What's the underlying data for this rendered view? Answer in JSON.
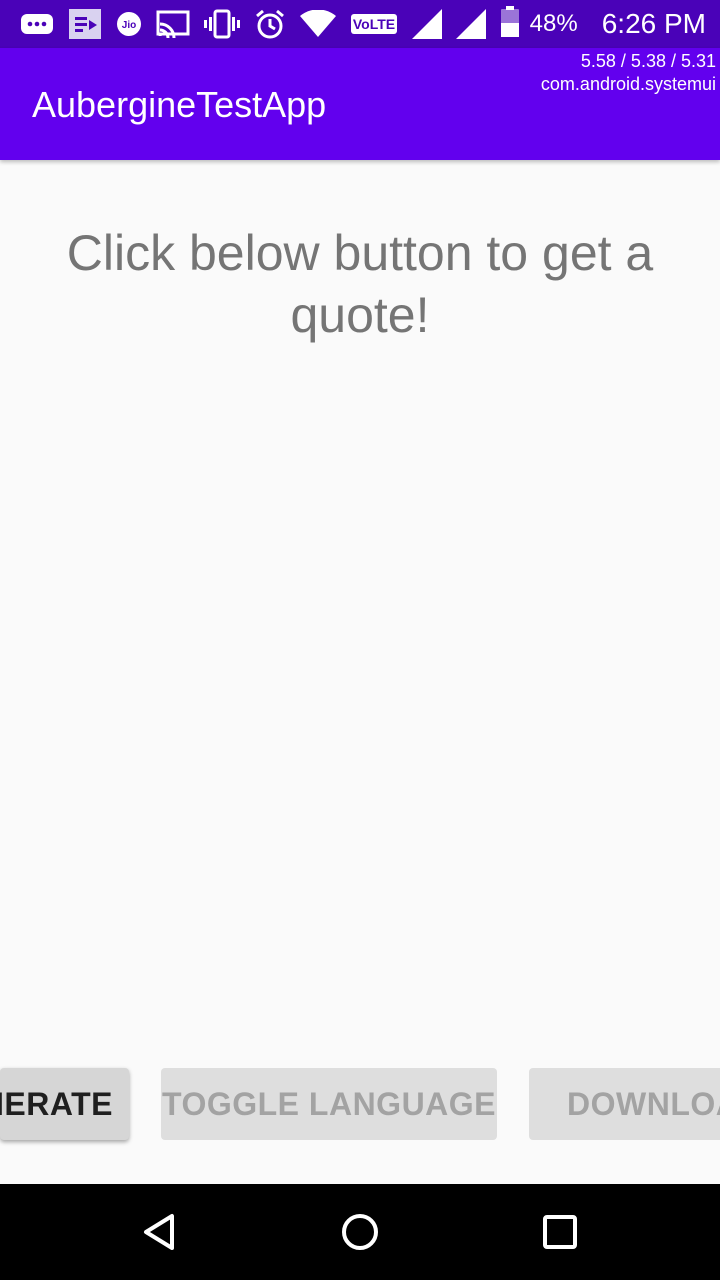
{
  "status_bar": {
    "battery_percent": "48%",
    "time": "6:26 PM",
    "jio_label": "Jio",
    "volte_label": "VoLTE",
    "icons": [
      "more-icon",
      "cast-media-icon",
      "jio-icon",
      "screen-cast-icon",
      "vibrate-icon",
      "alarm-icon",
      "wifi-icon",
      "volte-icon",
      "signal-icon",
      "signal-icon",
      "battery-icon"
    ]
  },
  "cpu_overlay": {
    "load": "5.58 / 5.38 / 5.31",
    "process": "com.android.systemui"
  },
  "app_bar": {
    "title": "AubergineTestApp"
  },
  "main": {
    "quote_text": "Click below button to get a quote!"
  },
  "buttons": {
    "generate_label": "NERATE",
    "toggle_language_label": "TOGGLE LANGUAGE",
    "download_label": "DOWNLOA"
  },
  "nav_bar": {
    "icons": [
      "back-icon",
      "home-icon",
      "recents-icon"
    ]
  },
  "colors": {
    "status_bar": "#4a02b8",
    "app_bar": "#6200ee",
    "background": "#fafafa",
    "quote_text": "#757575"
  }
}
